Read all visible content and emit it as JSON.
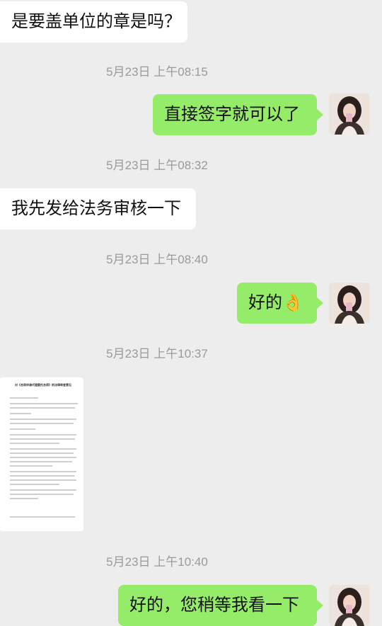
{
  "messages": [
    {
      "side": "in",
      "text": "是要盖单位的章是吗？"
    },
    {
      "time": "5月23日 上午08:15"
    },
    {
      "side": "out",
      "text": "直接签字就可以了"
    },
    {
      "time": "5月23日 上午08:32"
    },
    {
      "side": "in",
      "text": "我先发给法务审核一下"
    },
    {
      "time": "5月23日 上午08:40"
    },
    {
      "side": "out",
      "text": "好的👌"
    },
    {
      "time": "5月23日 上午10:37"
    },
    {
      "side": "in",
      "type": "image",
      "doc_title": "对《合同申请代理委托合同》的法律审查意见"
    },
    {
      "time": "5月23日 上午10:40"
    },
    {
      "side": "out",
      "text": "好的，您稍等我看一下"
    }
  ],
  "icons": {
    "avatar": "user-avatar-photo",
    "ok_emoji": "ok-hand-emoji"
  },
  "colors": {
    "background": "#ededed",
    "outgoing_bubble": "#95ec69",
    "incoming_bubble": "#ffffff",
    "timestamp": "#9a9a9a"
  }
}
